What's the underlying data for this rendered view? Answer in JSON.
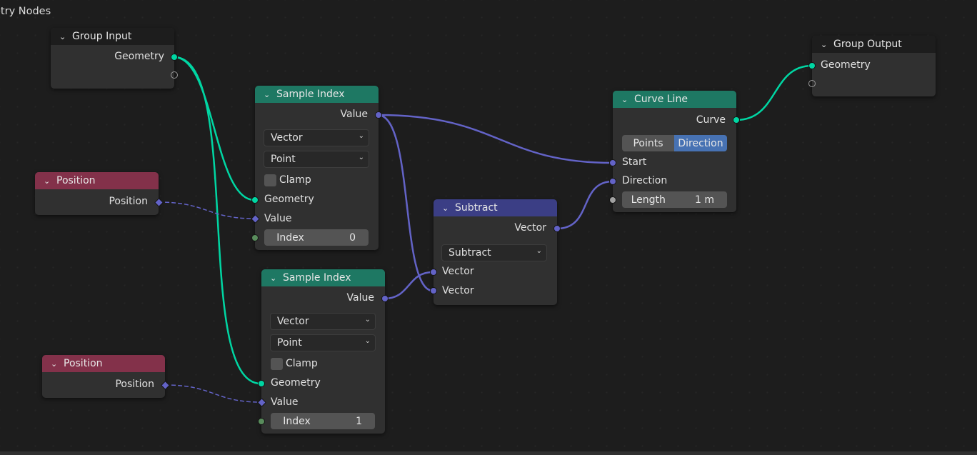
{
  "editor": {
    "title": "etry Nodes"
  },
  "colors": {
    "geometry_socket": "#00d6a3",
    "vector_socket": "#6363c7",
    "integer_socket": "#598c5c",
    "float_socket": "#a1a1a1",
    "input_header": "#83314a",
    "geometry_header": "#1e7863",
    "vector_header": "#3b3e85",
    "active_toggle": "#4772b3"
  },
  "nodes": {
    "group_input": {
      "title": "Group Input",
      "outputs": [
        "Geometry"
      ]
    },
    "position_1": {
      "title": "Position",
      "outputs": [
        "Position"
      ]
    },
    "position_2": {
      "title": "Position",
      "outputs": [
        "Position"
      ]
    },
    "sample_index_1": {
      "title": "Sample Index",
      "output": "Value",
      "data_type": "Vector",
      "domain": "Point",
      "clamp_label": "Clamp",
      "clamp_checked": false,
      "inputs": [
        "Geometry",
        "Value"
      ],
      "index_label": "Index",
      "index_value": "0"
    },
    "sample_index_2": {
      "title": "Sample Index",
      "output": "Value",
      "data_type": "Vector",
      "domain": "Point",
      "clamp_label": "Clamp",
      "clamp_checked": false,
      "inputs": [
        "Geometry",
        "Value"
      ],
      "index_label": "Index",
      "index_value": "1"
    },
    "subtract": {
      "title": "Subtract",
      "output": "Vector",
      "operation": "Subtract",
      "inputs": [
        "Vector",
        "Vector"
      ]
    },
    "curve_line": {
      "title": "Curve Line",
      "output": "Curve",
      "mode_options": [
        "Points",
        "Direction"
      ],
      "mode_selected": "Direction",
      "inputs": [
        "Start",
        "Direction"
      ],
      "length_label": "Length",
      "length_value": "1 m"
    },
    "group_output": {
      "title": "Group Output",
      "inputs": [
        "Geometry"
      ]
    }
  },
  "links": [
    {
      "from": "group_input.Geometry",
      "to": "sample_index_1.Geometry"
    },
    {
      "from": "group_input.Geometry",
      "to": "sample_index_2.Geometry"
    },
    {
      "from": "position_1.Position",
      "to": "sample_index_1.Value"
    },
    {
      "from": "position_2.Position",
      "to": "sample_index_2.Value"
    },
    {
      "from": "sample_index_1.Value",
      "to": "curve_line.Start"
    },
    {
      "from": "sample_index_1.Value",
      "to": "subtract.Vector_2"
    },
    {
      "from": "sample_index_2.Value",
      "to": "subtract.Vector_1"
    },
    {
      "from": "subtract.Vector",
      "to": "curve_line.Direction"
    },
    {
      "from": "curve_line.Curve",
      "to": "group_output.Geometry"
    }
  ]
}
